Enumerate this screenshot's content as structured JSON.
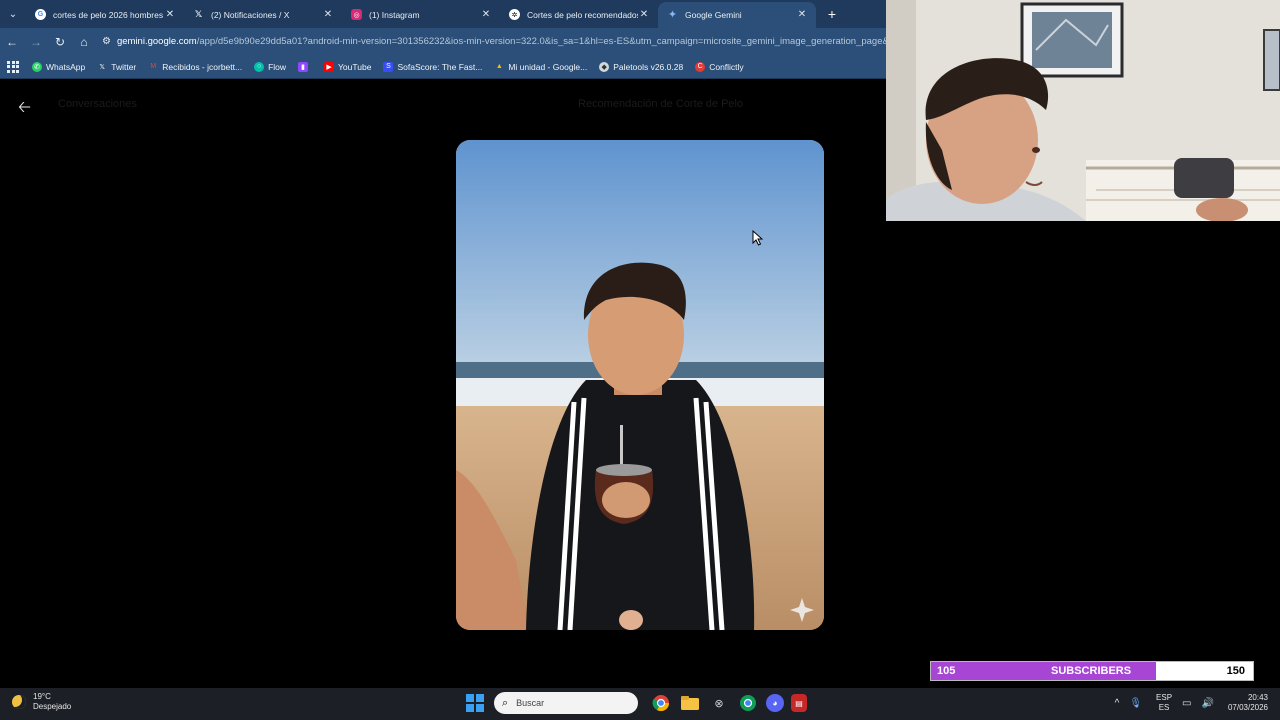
{
  "browser": {
    "tabs": [
      {
        "title": "cortes de pelo 2026 hombres -",
        "favicon": "google-icon",
        "active": false
      },
      {
        "title": "(2) Notificaciones / X",
        "favicon": "x-icon",
        "active": false
      },
      {
        "title": "(1) Instagram",
        "favicon": "instagram-icon",
        "active": false
      },
      {
        "title": "Cortes de pelo recomendados",
        "favicon": "chatgpt-icon",
        "active": false
      },
      {
        "title": "Google Gemini",
        "favicon": "gemini-icon",
        "active": true
      }
    ],
    "url_host": "gemini.google.com",
    "url_rest": "/app/d5e9b90e29dd5a01?android-min-version=301356232&ios-min-version=322.0&is_sa=1&hl=es-ES&utm_campaign=microsite_gemini_image_generation_page&",
    "bookmarks": [
      {
        "label": "WhatsApp",
        "icon": "whatsapp-icon",
        "color": "#25d366"
      },
      {
        "label": "Twitter",
        "icon": "x-icon",
        "color": "#000000"
      },
      {
        "label": "Recibidos - jcorbett...",
        "icon": "gmail-icon",
        "color": "#ea4335"
      },
      {
        "label": "Flow",
        "icon": "flow-icon",
        "color": "#00c2a8"
      },
      {
        "label": "",
        "icon": "twitch-icon",
        "color": "#9146ff"
      },
      {
        "label": "YouTube",
        "icon": "youtube-icon",
        "color": "#ff0000"
      },
      {
        "label": "SofaScore: The Fast...",
        "icon": "sofascore-icon",
        "color": "#374df5"
      },
      {
        "label": "Mi unidad - Google...",
        "icon": "drive-icon",
        "color": "#fbbc04"
      },
      {
        "label": "Paletools v26.0.28",
        "icon": "paletools-icon",
        "color": "#444444"
      },
      {
        "label": "Conflictly",
        "icon": "conflictly-icon",
        "color": "#e53935"
      }
    ]
  },
  "page": {
    "faint_title": "Recomendación de Corte de Pelo",
    "faint_left": "Conversaciones"
  },
  "stream": {
    "subscribers_current": "105",
    "subscribers_label": "SUBSCRIBERS",
    "subscribers_goal": "150",
    "progress_fraction": 0.7,
    "bar_color": "#a746d4"
  },
  "taskbar": {
    "temp": "19°C",
    "weather": "Despejado",
    "search_placeholder": "Buscar",
    "lang_top": "ESP",
    "lang_bottom": "ES",
    "time": "20:43",
    "date": "07/03/2026"
  }
}
